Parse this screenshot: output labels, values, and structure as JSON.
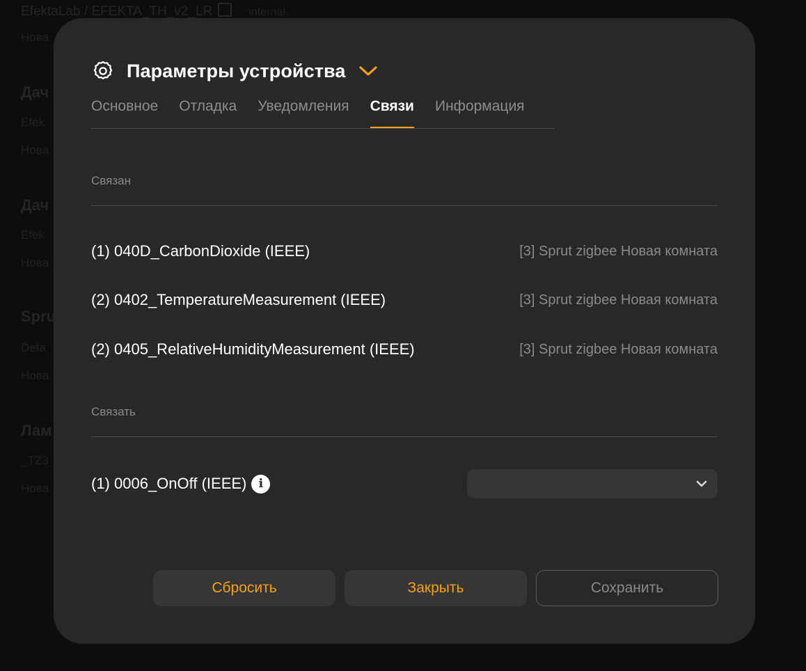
{
  "background": {
    "top_path": "EfektaLab / EFEKTA_TH_v2_LR",
    "top_tag": "internal",
    "top_sub": "Нова",
    "items": [
      {
        "title": "Дач",
        "sub1": "Efek",
        "sub2": "Нова"
      },
      {
        "title": "Дач",
        "sub1": "Efek",
        "sub2": "Нова"
      },
      {
        "title": "Spru",
        "sub1": "Defa",
        "sub2": "Нова"
      },
      {
        "title": "Лам",
        "sub1": "_TZ3",
        "sub2": "Нова"
      }
    ]
  },
  "modal": {
    "title": "Параметры устройства",
    "tabs": [
      {
        "label": "Основное",
        "active": false
      },
      {
        "label": "Отладка",
        "active": false
      },
      {
        "label": "Уведомления",
        "active": false
      },
      {
        "label": "Связи",
        "active": true
      },
      {
        "label": "Информация",
        "active": false
      }
    ],
    "bound_section": {
      "label": "Связан",
      "rows": [
        {
          "name": "(1) 040D_CarbonDioxide (IEEE)",
          "target": "[3] Sprut zigbee Новая комната"
        },
        {
          "name": "(2) 0402_TemperatureMeasurement (IEEE)",
          "target": "[3] Sprut zigbee Новая комната"
        },
        {
          "name": "(2) 0405_RelativeHumidityMeasurement (IEEE)",
          "target": "[3] Sprut zigbee Новая комната"
        }
      ]
    },
    "bind_section": {
      "label": "Связать",
      "row": {
        "name": "(1) 0006_OnOff (IEEE)",
        "select_value": ""
      }
    },
    "buttons": {
      "reset": "Сбросить",
      "close": "Закрыть",
      "save": "Сохранить"
    }
  },
  "colors": {
    "accent": "#f5a01a",
    "modal_bg": "#282828",
    "muted_text": "#8a8a8a"
  }
}
